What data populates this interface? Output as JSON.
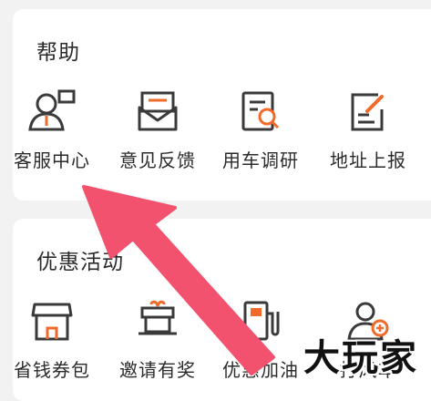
{
  "help": {
    "title": "帮助",
    "items": [
      {
        "label": "客服中心",
        "icon": "customer-service-icon"
      },
      {
        "label": "意见反馈",
        "icon": "feedback-envelope-icon"
      },
      {
        "label": "用车调研",
        "icon": "survey-search-icon"
      },
      {
        "label": "地址上报",
        "icon": "address-report-icon"
      }
    ]
  },
  "promo": {
    "title": "优惠活动",
    "items": [
      {
        "label": "省钱券包",
        "icon": "coupon-shop-icon"
      },
      {
        "label": "邀请有奖",
        "icon": "gift-invite-icon"
      },
      {
        "label": "优惠加油",
        "icon": "fuel-pump-icon"
      },
      {
        "label": "打风车",
        "icon": "user-add-icon"
      }
    ]
  },
  "watermark": "大玩家",
  "colors": {
    "accent": "#f26a2a",
    "stroke": "#3a3a3a",
    "arrow": "#f3526e"
  }
}
